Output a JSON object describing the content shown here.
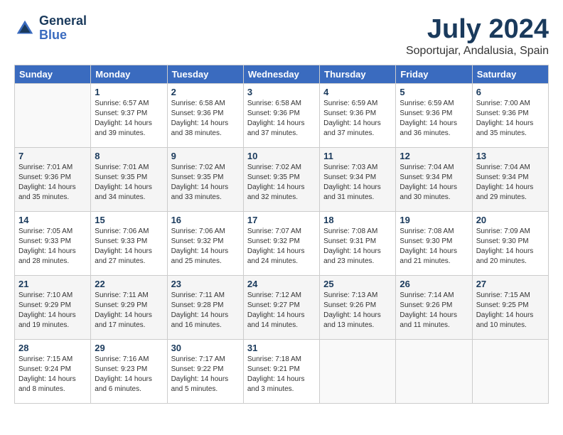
{
  "header": {
    "logo_line1": "General",
    "logo_line2": "Blue",
    "month_title": "July 2024",
    "location": "Soportujar, Andalusia, Spain"
  },
  "weekdays": [
    "Sunday",
    "Monday",
    "Tuesday",
    "Wednesday",
    "Thursday",
    "Friday",
    "Saturday"
  ],
  "weeks": [
    [
      {
        "day": "",
        "sunrise": "",
        "sunset": "",
        "daylight": ""
      },
      {
        "day": "1",
        "sunrise": "Sunrise: 6:57 AM",
        "sunset": "Sunset: 9:37 PM",
        "daylight": "Daylight: 14 hours and 39 minutes."
      },
      {
        "day": "2",
        "sunrise": "Sunrise: 6:58 AM",
        "sunset": "Sunset: 9:36 PM",
        "daylight": "Daylight: 14 hours and 38 minutes."
      },
      {
        "day": "3",
        "sunrise": "Sunrise: 6:58 AM",
        "sunset": "Sunset: 9:36 PM",
        "daylight": "Daylight: 14 hours and 37 minutes."
      },
      {
        "day": "4",
        "sunrise": "Sunrise: 6:59 AM",
        "sunset": "Sunset: 9:36 PM",
        "daylight": "Daylight: 14 hours and 37 minutes."
      },
      {
        "day": "5",
        "sunrise": "Sunrise: 6:59 AM",
        "sunset": "Sunset: 9:36 PM",
        "daylight": "Daylight: 14 hours and 36 minutes."
      },
      {
        "day": "6",
        "sunrise": "Sunrise: 7:00 AM",
        "sunset": "Sunset: 9:36 PM",
        "daylight": "Daylight: 14 hours and 35 minutes."
      }
    ],
    [
      {
        "day": "7",
        "sunrise": "Sunrise: 7:01 AM",
        "sunset": "Sunset: 9:36 PM",
        "daylight": "Daylight: 14 hours and 35 minutes."
      },
      {
        "day": "8",
        "sunrise": "Sunrise: 7:01 AM",
        "sunset": "Sunset: 9:35 PM",
        "daylight": "Daylight: 14 hours and 34 minutes."
      },
      {
        "day": "9",
        "sunrise": "Sunrise: 7:02 AM",
        "sunset": "Sunset: 9:35 PM",
        "daylight": "Daylight: 14 hours and 33 minutes."
      },
      {
        "day": "10",
        "sunrise": "Sunrise: 7:02 AM",
        "sunset": "Sunset: 9:35 PM",
        "daylight": "Daylight: 14 hours and 32 minutes."
      },
      {
        "day": "11",
        "sunrise": "Sunrise: 7:03 AM",
        "sunset": "Sunset: 9:34 PM",
        "daylight": "Daylight: 14 hours and 31 minutes."
      },
      {
        "day": "12",
        "sunrise": "Sunrise: 7:04 AM",
        "sunset": "Sunset: 9:34 PM",
        "daylight": "Daylight: 14 hours and 30 minutes."
      },
      {
        "day": "13",
        "sunrise": "Sunrise: 7:04 AM",
        "sunset": "Sunset: 9:34 PM",
        "daylight": "Daylight: 14 hours and 29 minutes."
      }
    ],
    [
      {
        "day": "14",
        "sunrise": "Sunrise: 7:05 AM",
        "sunset": "Sunset: 9:33 PM",
        "daylight": "Daylight: 14 hours and 28 minutes."
      },
      {
        "day": "15",
        "sunrise": "Sunrise: 7:06 AM",
        "sunset": "Sunset: 9:33 PM",
        "daylight": "Daylight: 14 hours and 27 minutes."
      },
      {
        "day": "16",
        "sunrise": "Sunrise: 7:06 AM",
        "sunset": "Sunset: 9:32 PM",
        "daylight": "Daylight: 14 hours and 25 minutes."
      },
      {
        "day": "17",
        "sunrise": "Sunrise: 7:07 AM",
        "sunset": "Sunset: 9:32 PM",
        "daylight": "Daylight: 14 hours and 24 minutes."
      },
      {
        "day": "18",
        "sunrise": "Sunrise: 7:08 AM",
        "sunset": "Sunset: 9:31 PM",
        "daylight": "Daylight: 14 hours and 23 minutes."
      },
      {
        "day": "19",
        "sunrise": "Sunrise: 7:08 AM",
        "sunset": "Sunset: 9:30 PM",
        "daylight": "Daylight: 14 hours and 21 minutes."
      },
      {
        "day": "20",
        "sunrise": "Sunrise: 7:09 AM",
        "sunset": "Sunset: 9:30 PM",
        "daylight": "Daylight: 14 hours and 20 minutes."
      }
    ],
    [
      {
        "day": "21",
        "sunrise": "Sunrise: 7:10 AM",
        "sunset": "Sunset: 9:29 PM",
        "daylight": "Daylight: 14 hours and 19 minutes."
      },
      {
        "day": "22",
        "sunrise": "Sunrise: 7:11 AM",
        "sunset": "Sunset: 9:29 PM",
        "daylight": "Daylight: 14 hours and 17 minutes."
      },
      {
        "day": "23",
        "sunrise": "Sunrise: 7:11 AM",
        "sunset": "Sunset: 9:28 PM",
        "daylight": "Daylight: 14 hours and 16 minutes."
      },
      {
        "day": "24",
        "sunrise": "Sunrise: 7:12 AM",
        "sunset": "Sunset: 9:27 PM",
        "daylight": "Daylight: 14 hours and 14 minutes."
      },
      {
        "day": "25",
        "sunrise": "Sunrise: 7:13 AM",
        "sunset": "Sunset: 9:26 PM",
        "daylight": "Daylight: 14 hours and 13 minutes."
      },
      {
        "day": "26",
        "sunrise": "Sunrise: 7:14 AM",
        "sunset": "Sunset: 9:26 PM",
        "daylight": "Daylight: 14 hours and 11 minutes."
      },
      {
        "day": "27",
        "sunrise": "Sunrise: 7:15 AM",
        "sunset": "Sunset: 9:25 PM",
        "daylight": "Daylight: 14 hours and 10 minutes."
      }
    ],
    [
      {
        "day": "28",
        "sunrise": "Sunrise: 7:15 AM",
        "sunset": "Sunset: 9:24 PM",
        "daylight": "Daylight: 14 hours and 8 minutes."
      },
      {
        "day": "29",
        "sunrise": "Sunrise: 7:16 AM",
        "sunset": "Sunset: 9:23 PM",
        "daylight": "Daylight: 14 hours and 6 minutes."
      },
      {
        "day": "30",
        "sunrise": "Sunrise: 7:17 AM",
        "sunset": "Sunset: 9:22 PM",
        "daylight": "Daylight: 14 hours and 5 minutes."
      },
      {
        "day": "31",
        "sunrise": "Sunrise: 7:18 AM",
        "sunset": "Sunset: 9:21 PM",
        "daylight": "Daylight: 14 hours and 3 minutes."
      },
      {
        "day": "",
        "sunrise": "",
        "sunset": "",
        "daylight": ""
      },
      {
        "day": "",
        "sunrise": "",
        "sunset": "",
        "daylight": ""
      },
      {
        "day": "",
        "sunrise": "",
        "sunset": "",
        "daylight": ""
      }
    ]
  ]
}
